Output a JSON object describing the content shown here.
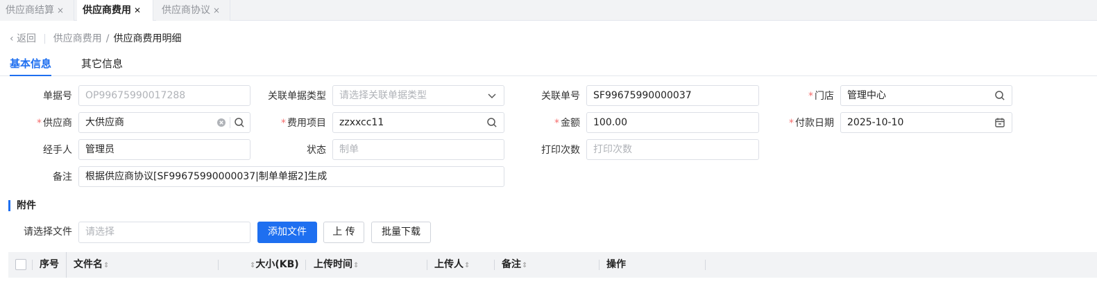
{
  "tabs": [
    {
      "label": "供应商结算",
      "close": "×",
      "active": false
    },
    {
      "label": "供应商费用",
      "close": "✕",
      "active": true
    },
    {
      "label": "供应商协议",
      "close": "×",
      "active": false
    }
  ],
  "breadcrumb": {
    "back": "返回",
    "parent": "供应商费用",
    "separator": "/",
    "current": "供应商费用明细"
  },
  "section_tabs": [
    "基本信息",
    "其它信息"
  ],
  "form": {
    "doc_no": {
      "label": "单据号",
      "value": "OP99675990017288"
    },
    "ref_type": {
      "label": "关联单据类型",
      "placeholder": "请选择关联单据类型"
    },
    "ref_no": {
      "label": "关联单号",
      "value": "SF99675990000037"
    },
    "store": {
      "label": "门店",
      "value": "管理中心",
      "required": "*"
    },
    "supplier": {
      "label": "供应商",
      "value": "大供应商",
      "required": "*"
    },
    "fee_item": {
      "label": "费用项目",
      "value": "zzxxcc11",
      "required": "*"
    },
    "amount": {
      "label": "金额",
      "value": "100.00",
      "required": "*"
    },
    "pay_date": {
      "label": "付款日期",
      "value": "2025-10-10",
      "required": "*"
    },
    "handler": {
      "label": "经手人",
      "value": "管理员"
    },
    "status": {
      "label": "状态",
      "value": "制单"
    },
    "print_count": {
      "label": "打印次数",
      "placeholder": "打印次数"
    },
    "remark": {
      "label": "备注",
      "value": "根据供应商协议[SF99675990000037|制单单据2]生成"
    }
  },
  "attachment": {
    "title": "附件",
    "file_label": "请选择文件",
    "file_placeholder": "请选择",
    "add_button": "添加文件",
    "upload_button": "上 传",
    "download_button": "批量下载"
  },
  "table": {
    "sort_glyph": "⇕",
    "columns": [
      "序号",
      "文件名",
      "大小(KB)",
      "上传时间",
      "上传人",
      "备注",
      "操作"
    ]
  },
  "colors": {
    "accent": "#1e6ff0",
    "required": "#f56c6c"
  }
}
